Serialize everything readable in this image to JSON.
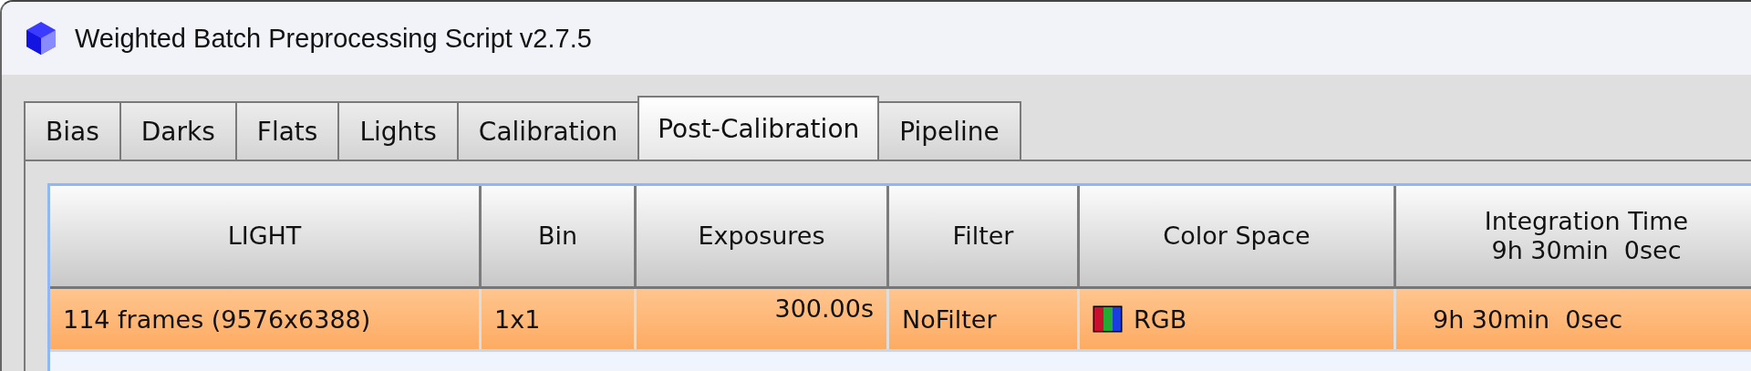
{
  "window": {
    "title": "Weighted Batch Preprocessing Script v2.7.5"
  },
  "tabs": [
    {
      "label": "Bias",
      "selected": false
    },
    {
      "label": "Darks",
      "selected": false
    },
    {
      "label": "Flats",
      "selected": false
    },
    {
      "label": "Lights",
      "selected": false
    },
    {
      "label": "Calibration",
      "selected": false
    },
    {
      "label": "Post-Calibration",
      "selected": true
    },
    {
      "label": "Pipeline",
      "selected": false
    }
  ],
  "table": {
    "columns": [
      "LIGHT",
      "Bin",
      "Exposures",
      "Filter",
      "Color Space",
      "Integration Time\n9h 30min  0sec"
    ],
    "rows": [
      {
        "selected": true,
        "cells": [
          {
            "text": "114 frames (9576x6388)",
            "kind": "text"
          },
          {
            "text": "1x1",
            "kind": "text"
          },
          {
            "text": "300.00s",
            "kind": "number"
          },
          {
            "text": "NoFilter",
            "kind": "text"
          },
          {
            "text": "RGB",
            "kind": "color"
          },
          {
            "text": "9h 30min  0sec",
            "kind": "text"
          }
        ]
      }
    ]
  }
}
